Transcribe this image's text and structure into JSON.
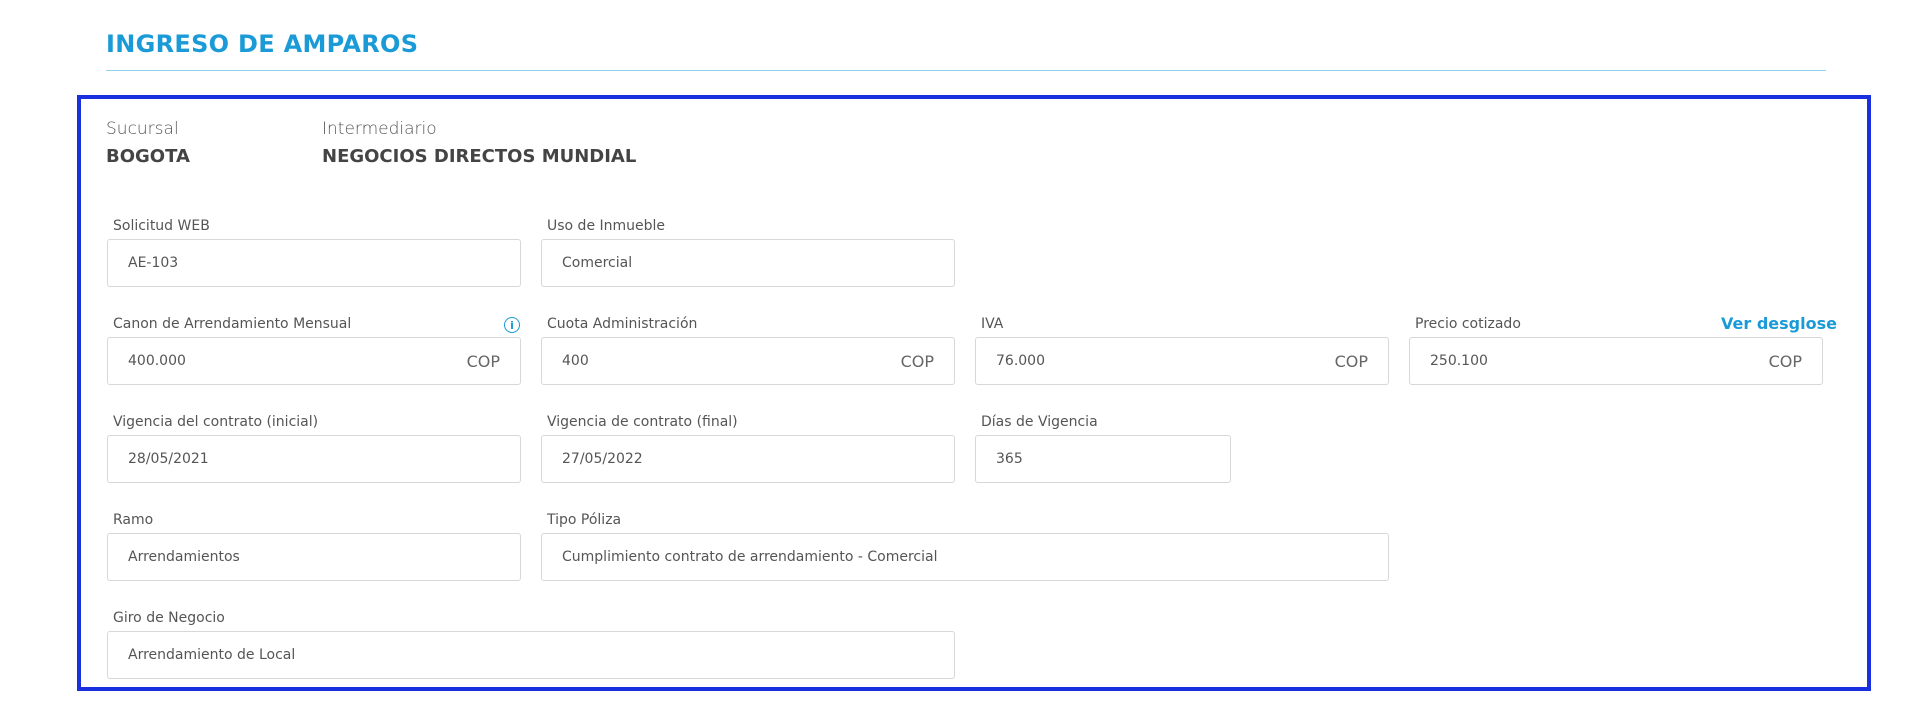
{
  "header": {
    "title": "INGRESO DE AMPAROS"
  },
  "info": {
    "sucursal_label": "Sucursal",
    "sucursal_value": "BOGOTA",
    "intermediario_label": "Intermediario",
    "intermediario_value": "NEGOCIOS DIRECTOS MUNDIAL"
  },
  "form": {
    "solicitud_web": {
      "label": "Solicitud WEB",
      "value": "AE-103"
    },
    "uso_inmueble": {
      "label": "Uso de Inmueble",
      "value": "Comercial"
    },
    "canon": {
      "label": "Canon de Arrendamiento Mensual",
      "value": "400.000",
      "currency": "COP",
      "icon": "info-icon"
    },
    "cuota_admin": {
      "label": "Cuota Administración",
      "value": "400",
      "currency": "COP"
    },
    "iva": {
      "label": "IVA",
      "value": "76.000",
      "currency": "COP"
    },
    "precio": {
      "label": "Precio cotizado",
      "value": "250.100",
      "currency": "COP",
      "link": "Ver desglose"
    },
    "vigencia_inicial": {
      "label": "Vigencia del contrato (inicial)",
      "value": "28/05/2021"
    },
    "vigencia_final": {
      "label": "Vigencia de contrato (final)",
      "value": "27/05/2022"
    },
    "dias_vigencia": {
      "label": "Días de Vigencia",
      "value": "365"
    },
    "ramo": {
      "label": "Ramo",
      "value": "Arrendamientos"
    },
    "tipo_poliza": {
      "label": "Tipo Póliza",
      "value": "Cumplimiento contrato de arrendamiento - Comercial"
    },
    "giro_negocio": {
      "label": "Giro de Negocio",
      "value": "Arrendamiento de Local"
    }
  },
  "colors": {
    "accent": "#1a9ad6",
    "panel_border": "#1a2fe0"
  }
}
